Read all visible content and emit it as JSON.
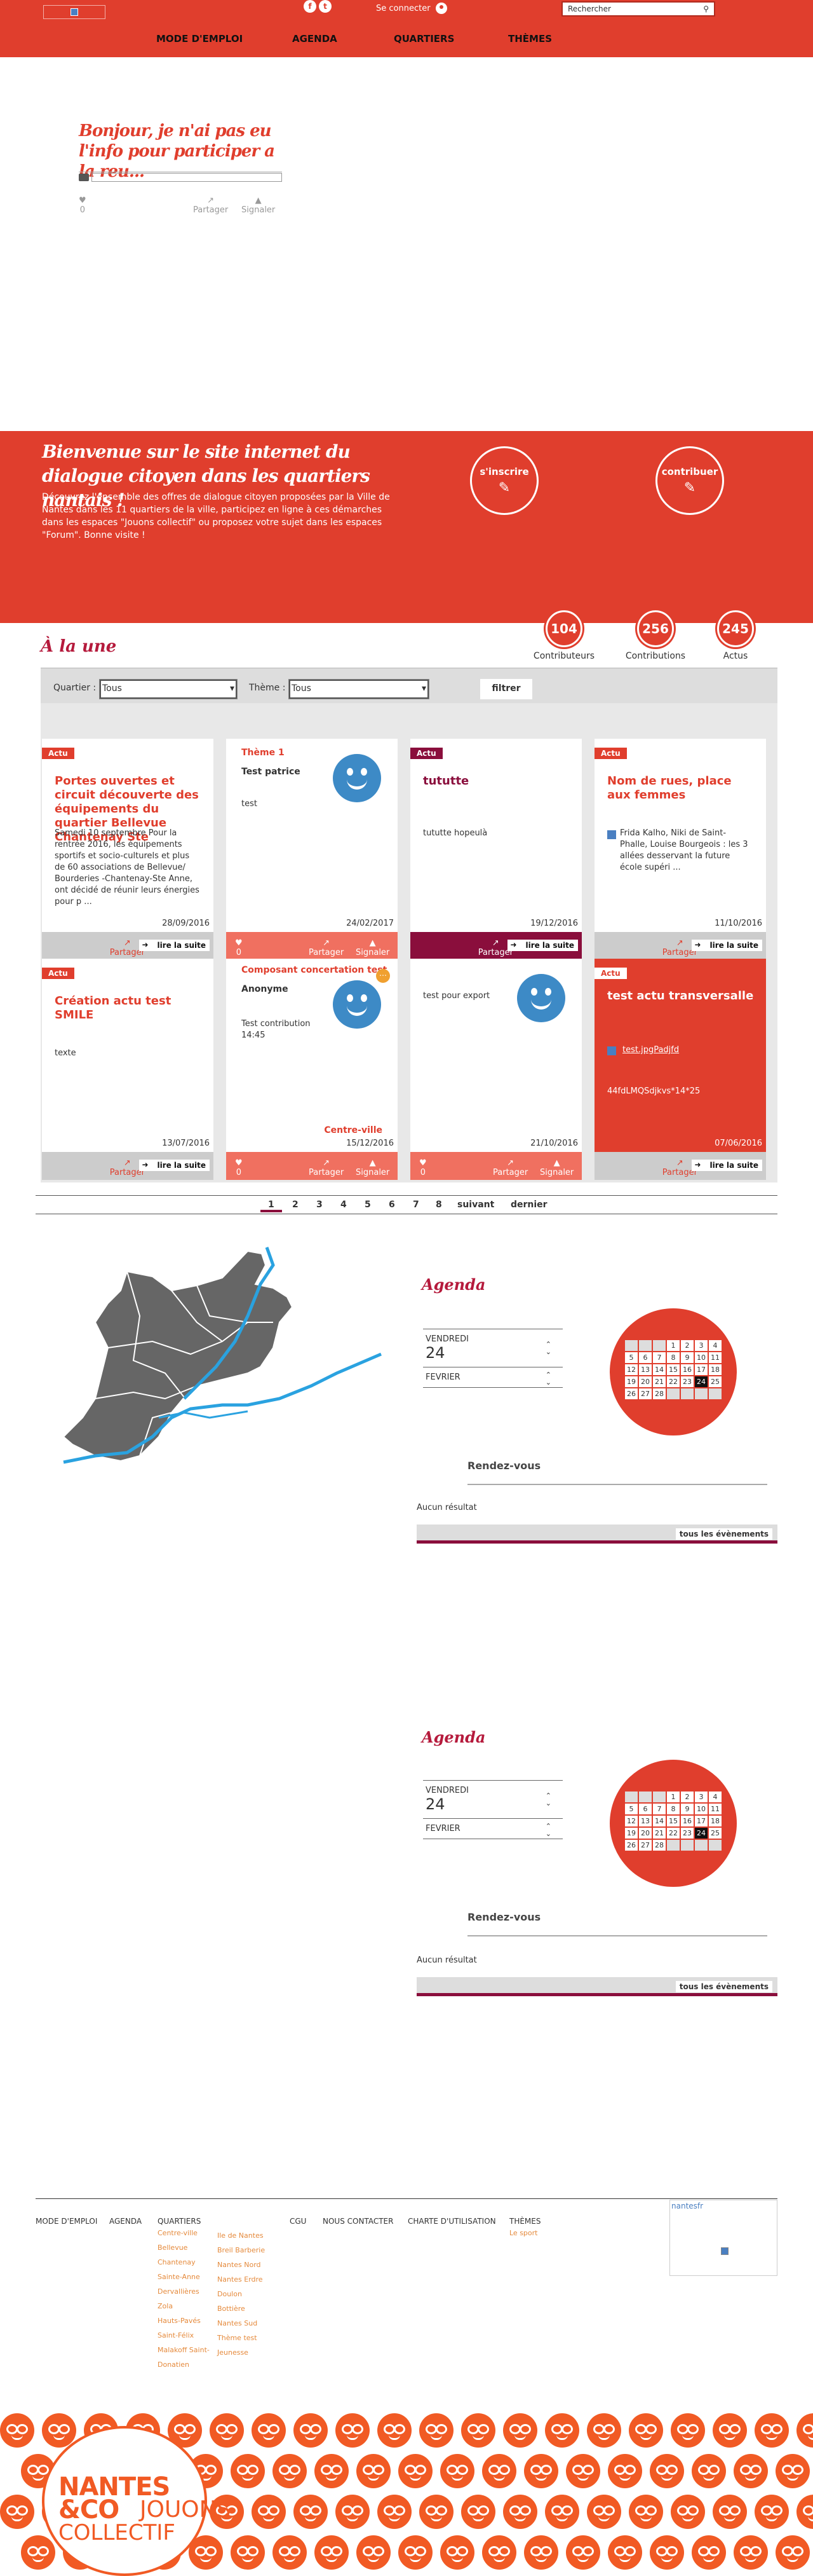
{
  "header": {
    "social": [
      "f",
      "t"
    ],
    "connect_label": "Se connecter",
    "search_placeholder": "Rechercher",
    "nav": [
      "MODE D'EMPLOI",
      "AGENDA",
      "QUARTIERS",
      "THÈMES"
    ]
  },
  "question": {
    "title": "Bonjour, je n'ai pas eu l'info pour participer a la reu...",
    "likes": "0",
    "share_label": "Partager",
    "report_label": "Signaler"
  },
  "welcome": {
    "title": "Bienvenue sur le site internet du dialogue citoyen dans les quartiers nantais !",
    "text": "Découvrez l'ensemble des offres de dialogue citoyen proposées par la Ville de Nantes dans les 11 quartiers de la ville, participez en ligne à ces démarches dans les espaces \"Jouons collectif\" ou proposez votre sujet dans les espaces \"Forum\". Bonne visite !",
    "signup_label": "s'inscrire",
    "contribute_label": "contribuer"
  },
  "une": {
    "title": "À la une",
    "stats": [
      {
        "value": "104",
        "label": "Contributeurs"
      },
      {
        "value": "256",
        "label": "Contributions"
      },
      {
        "value": "245",
        "label": "Actus"
      }
    ],
    "filter": {
      "quartier_label": "Quartier :",
      "quartier_value": "Tous",
      "theme_label": "Thème :",
      "theme_value": "Tous",
      "button": "filtrer"
    }
  },
  "cards": [
    {
      "tag": "Actu",
      "title": "Portes ouvertes et circuit découverte des équipements du quartier Bellevue Chantenay Ste",
      "body": "Samedi 10 septembre Pour la rentrée 2016, les équipements sportifs et socio-culturels et plus de 60 associations de Bellevue/ Bourderies -Chantenay-Ste Anne, ont décidé de réunir leurs énergies pour p ...",
      "date": "28/09/2016",
      "share": "Partager",
      "more": "lire la suite"
    },
    {
      "theme": "Thème 1",
      "sub": "Test patrice",
      "body": "test",
      "date": "24/02/2017",
      "likes": "0",
      "share": "Partager",
      "report": "Signaler"
    },
    {
      "tag": "Actu",
      "title": "tututte",
      "body": "tututte hopeulà",
      "date": "19/12/2016",
      "share": "Partager",
      "more": "lire la suite"
    },
    {
      "tag": "Actu",
      "title": "Nom de rues, place aux femmes",
      "body": "Frida Kalho, Niki de Saint-Phalle, Louise Bourgeois : les 3 allées desservant la future école supéri ...",
      "date": "11/10/2016",
      "share": "Partager",
      "more": "lire la suite"
    },
    {
      "tag": "Actu",
      "title": "Création actu test SMILE",
      "body": "texte",
      "date": "13/07/2016",
      "share": "Partager",
      "more": "lire la suite"
    },
    {
      "theme": "Composant concertation test",
      "sub": "Anonyme",
      "body": "Test contribution 14:45",
      "place": "Centre-ville",
      "date": "15/12/2016",
      "likes": "0",
      "share": "Partager",
      "report": "Signaler"
    },
    {
      "body": "test pour export",
      "date": "21/10/2016",
      "likes": "0",
      "share": "Partager",
      "report": "Signaler"
    },
    {
      "tag": "Actu",
      "title": "test actu transversalle",
      "link": "test.jpgPadjfd",
      "body": "44fdLMQSdjkvs*14*25",
      "date": "07/06/2016",
      "share": "Partager",
      "more": "lire la suite"
    }
  ],
  "pagination": [
    "1",
    "2",
    "3",
    "4",
    "5",
    "6",
    "7",
    "8",
    "suivant",
    "dernier"
  ],
  "agenda": {
    "title": "Agenda",
    "day_label": "VENDREDI",
    "day": "24",
    "month": "FEVRIER",
    "rdv_title": "Rendez-vous",
    "no_result": "Aucun résultat",
    "all_events": "tous les évènements",
    "calendar": [
      "",
      "",
      "",
      "1",
      "2",
      "3",
      "4",
      "5",
      "6",
      "7",
      "8",
      "9",
      "10",
      "11",
      "12",
      "13",
      "14",
      "15",
      "16",
      "17",
      "18",
      "19",
      "20",
      "21",
      "22",
      "23",
      "24",
      "25",
      "26",
      "27",
      "28",
      "",
      "",
      "",
      ""
    ]
  },
  "footer": {
    "links": [
      "MODE D'EMPLOI",
      "AGENDA",
      "QUARTIERS",
      "CGU",
      "NOUS CONTACTER",
      "CHARTE D'UTILISATION",
      "THÈMES"
    ],
    "quartiers_col1": [
      "Centre-ville",
      "Bellevue",
      "Chantenay",
      "Sainte-Anne",
      "Dervallières",
      "Zola",
      "Hauts-Pavés",
      "Saint-Félix",
      "Malakoff Saint-",
      "Donatien"
    ],
    "quartiers_col2": [
      "Ile de Nantes",
      "Breil Barberie",
      "Nantes Nord",
      "Nantes Erdre",
      "Doulon",
      "Bottière",
      "Nantes Sud",
      "Thème test",
      "Jeunesse"
    ],
    "themes": [
      "Le sport"
    ],
    "twitter": "nantesfr"
  },
  "brand": {
    "line1": "NANTES",
    "line2": "&CO",
    "line3": "JOUONS",
    "line4": "COLLECTIF"
  },
  "colors": {
    "primary": "#e03e2d",
    "accent": "#8a0e3c",
    "blue": "#3d8ac6",
    "orange": "#f15a24"
  }
}
